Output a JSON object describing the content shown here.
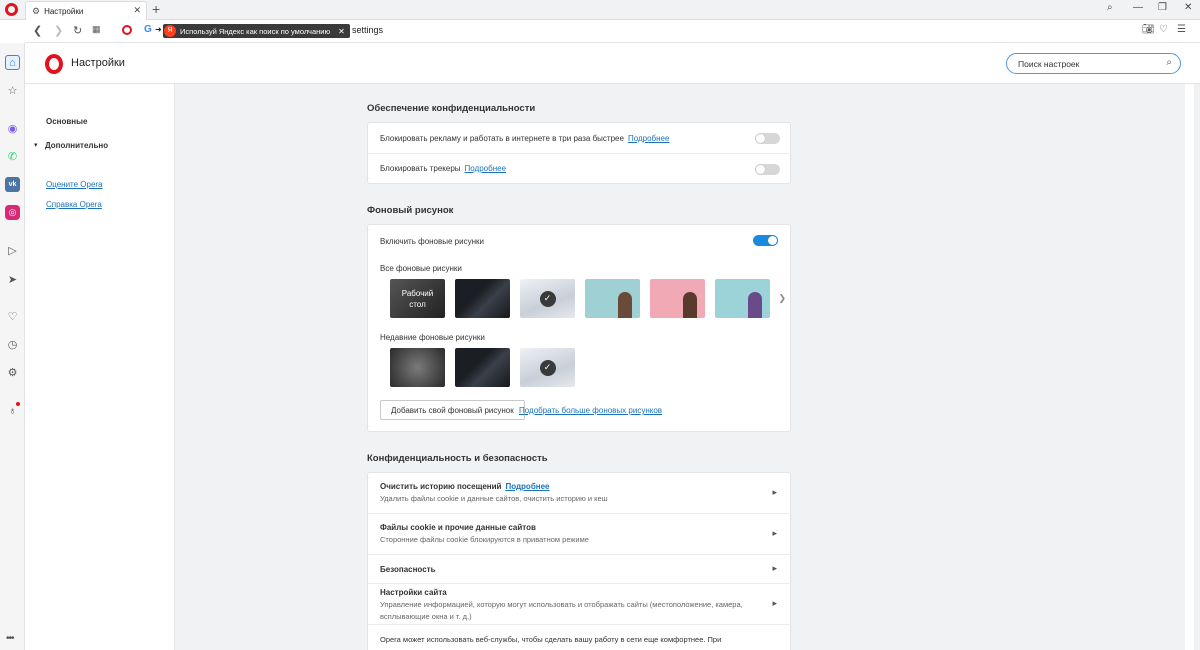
{
  "tab": {
    "title": "Настройки"
  },
  "addressbar": {
    "yandex_prompt": "Используй Яндекс как поиск по умолчанию",
    "url": "settings"
  },
  "header": {
    "title": "Настройки",
    "search_placeholder": "Поиск настроек"
  },
  "leftnav": {
    "basic": "Основные",
    "advanced": "Дополнительно",
    "rate": "Оцените Opera",
    "help": "Справка Opera"
  },
  "privacy_protection": {
    "heading": "Обеспечение конфиденциальности",
    "rows": [
      {
        "label": "Блокировать рекламу и работать в интернете в три раза быстрее",
        "link": "Подробнее",
        "enabled": false
      },
      {
        "label": "Блокировать трекеры",
        "link": "Подробнее",
        "enabled": false
      }
    ]
  },
  "wallpaper": {
    "heading": "Фоновый рисунок",
    "enable_label": "Включить фоновые рисунки",
    "enabled": true,
    "all_label": "Все фоновые рисунки",
    "desktop_tile_line1": "Рабочий",
    "desktop_tile_line2": "стол",
    "recent_label": "Недавние фоновые рисунки",
    "add_button": "Добавить свой фоновый рисунок",
    "more_link": "Подобрать больше фоновых рисунков"
  },
  "privacy_security": {
    "heading": "Конфиденциальность и безопасность",
    "rows": [
      {
        "title": "Очистить историю посещений",
        "link": "Подробнее",
        "desc": "Удалить файлы cookie и данные сайтов, очистить историю и кеш"
      },
      {
        "title": "Файлы cookie и прочие данные сайтов",
        "desc": "Сторонние файлы cookie блокируются в приватном режиме"
      },
      {
        "title": "Безопасность"
      },
      {
        "title": "Настройки сайта",
        "desc": "Управление информацией, которую могут использовать и отображать сайты (местоположение, камера, всплывающие окна и т. д.)"
      }
    ],
    "footer_text": "Opera может использовать веб-службы, чтобы сделать вашу работу в сети еще комфортнее. При"
  },
  "colors": {
    "accent": "#1a8ae0",
    "opera_red": "#e0131e",
    "link": "#1a73b8"
  }
}
